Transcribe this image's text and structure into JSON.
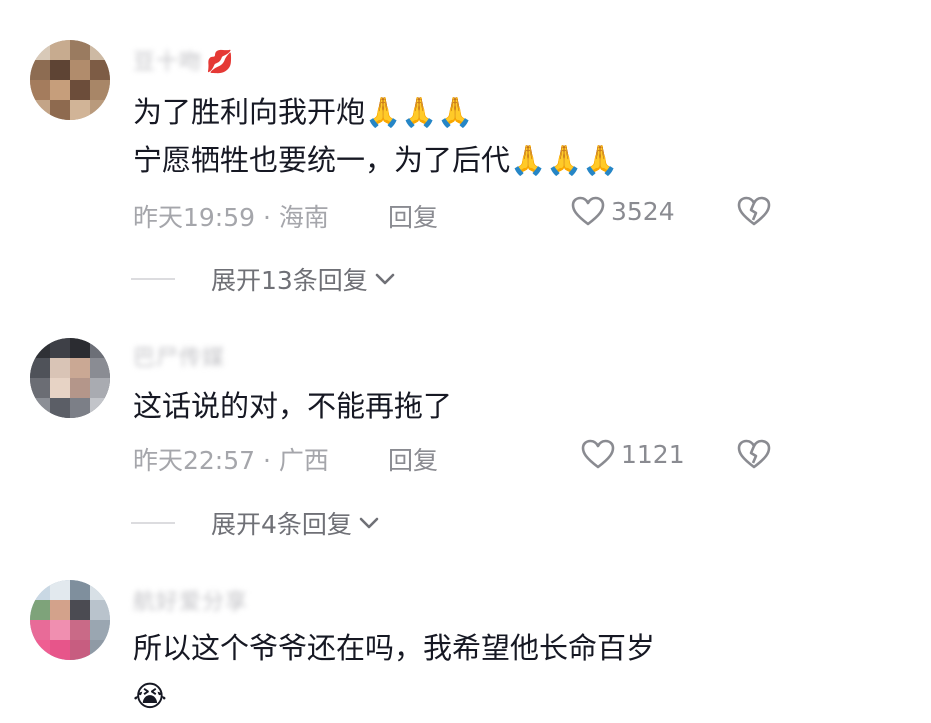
{
  "comments": [
    {
      "username": "豆十吻",
      "username_emoji": "💋",
      "lines": [
        "为了胜利向我开炮🙏🙏🙏",
        "宁愿牺牲也要统一，为了后代🙏🙏🙏"
      ],
      "meta": "昨天19:59 · 海南",
      "reply_label": "回复",
      "like_count": "3524",
      "expand_label": "展开13条回复"
    },
    {
      "username": "巴尸传媒",
      "lines": [
        "这话说的对，不能再拖了"
      ],
      "meta": "昨天22:57 · 广西",
      "reply_label": "回复",
      "like_count": "1121",
      "expand_label": "展开4条回复"
    },
    {
      "username": "航好爱分享",
      "lines": [
        "所以这个爷爷还在吗，我希望他长命百岁",
        "😭"
      ]
    }
  ],
  "icons": {
    "heart": "heart-icon",
    "broken_heart": "broken-heart-icon",
    "chevron": "chevron-down-icon"
  },
  "colors": {
    "text_primary": "#161823",
    "text_meta": "#a5a6ab",
    "text_action": "#8a8b91"
  }
}
